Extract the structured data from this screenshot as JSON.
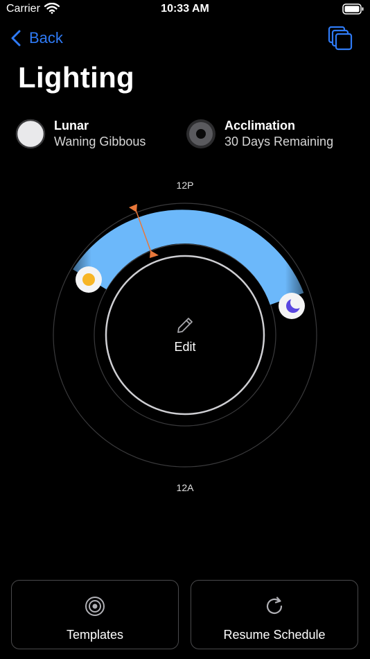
{
  "status": {
    "carrier": "Carrier",
    "time": "10:33 AM"
  },
  "nav": {
    "back_label": "Back"
  },
  "page": {
    "title": "Lighting"
  },
  "lunar": {
    "title": "Lunar",
    "subtitle": "Waning Gibbous"
  },
  "acclimation": {
    "title": "Acclimation",
    "subtitle": "30 Days Remaining"
  },
  "dial": {
    "top_label": "12P",
    "bottom_label": "12A",
    "center_label": "Edit",
    "accent_color": "#6cb8fa",
    "marker_color": "#e8773a"
  },
  "actions": {
    "templates_label": "Templates",
    "resume_label": "Resume Schedule"
  },
  "colors": {
    "link": "#2f7bf6",
    "background": "#000000"
  }
}
